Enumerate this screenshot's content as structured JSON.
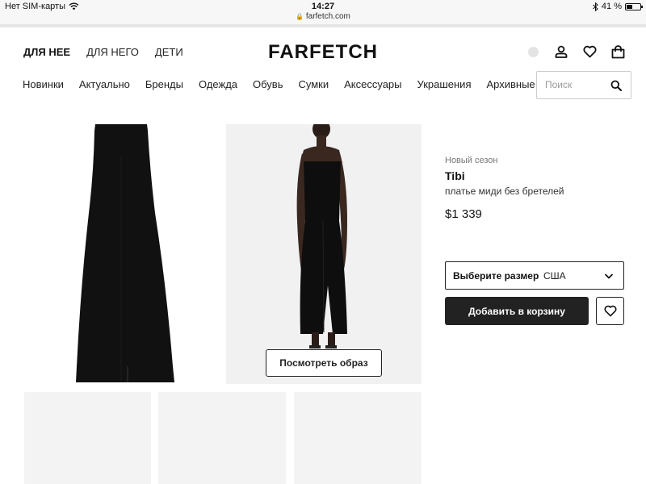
{
  "status_bar": {
    "carrier": "Нет SIM-карты",
    "time": "14:27",
    "url": "farfetch.com",
    "battery": "41 %",
    "battery_level": 0.41
  },
  "header": {
    "gender_tabs": [
      "ДЛЯ НЕЕ",
      "ДЛЯ НЕГО",
      "ДЕТИ"
    ],
    "active_gender": "ДЛЯ НЕЕ",
    "logo": "FARFETCH",
    "icons": [
      "region-dot",
      "account-icon",
      "heart-icon",
      "bag-icon"
    ]
  },
  "nav": {
    "items": [
      "Новинки",
      "Актуально",
      "Бренды",
      "Одежда",
      "Обувь",
      "Сумки",
      "Аксессуары",
      "Украшения",
      "Архивные"
    ]
  },
  "search": {
    "placeholder": "Поиск",
    "value": ""
  },
  "gallery": {
    "look_button": "Посмотреть образ",
    "dress_color": "#111111"
  },
  "product": {
    "season": "Новый сезон",
    "brand": "Tibi",
    "description": "платье миди без бретелей",
    "price": "$1 339",
    "size_label": "Выберите размер",
    "size_system": "США",
    "add_to_cart": "Добавить в корзину"
  },
  "colors": {
    "primary": "#222222",
    "background": "#ffffff",
    "placeholder_tile": "#f3f3f3"
  }
}
